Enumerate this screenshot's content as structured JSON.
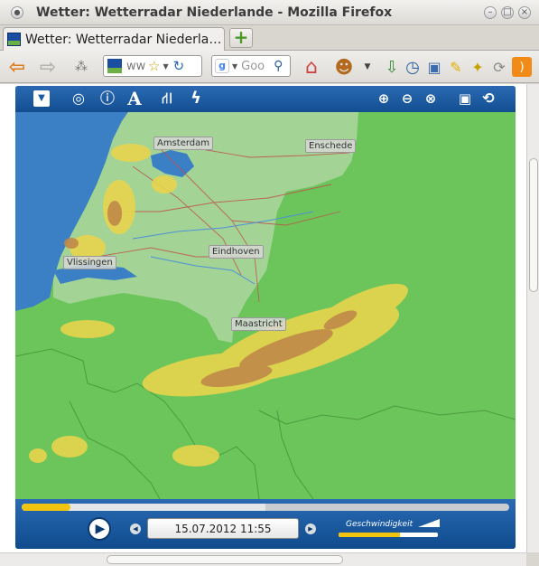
{
  "window": {
    "title": "Wetter: Wetterradar Niederlande - Mozilla Firefox"
  },
  "tab": {
    "label": "Wetter: Wetterradar Niederla…",
    "new_tab_glyph": "+"
  },
  "urlbar": {
    "value": "ww"
  },
  "searchbar": {
    "value": "Goo"
  },
  "map": {
    "cities": [
      {
        "name": "Amsterdam"
      },
      {
        "name": "Enschede"
      },
      {
        "name": "Vlissingen"
      },
      {
        "name": "Eindhoven"
      },
      {
        "name": "Maastricht"
      }
    ],
    "colors": {
      "sea": "#3b7fc4",
      "land_nl": "#a3d496",
      "land_other": "#6cc55a",
      "rain_light": "#e8d44d",
      "rain_heavy": "#c0884a"
    }
  },
  "player": {
    "datetime": "15.07.2012 11:55",
    "speed_label": "Geschwindigkeit",
    "progress": 0.1,
    "buffered": 0.5,
    "speed_level": 0.62
  }
}
